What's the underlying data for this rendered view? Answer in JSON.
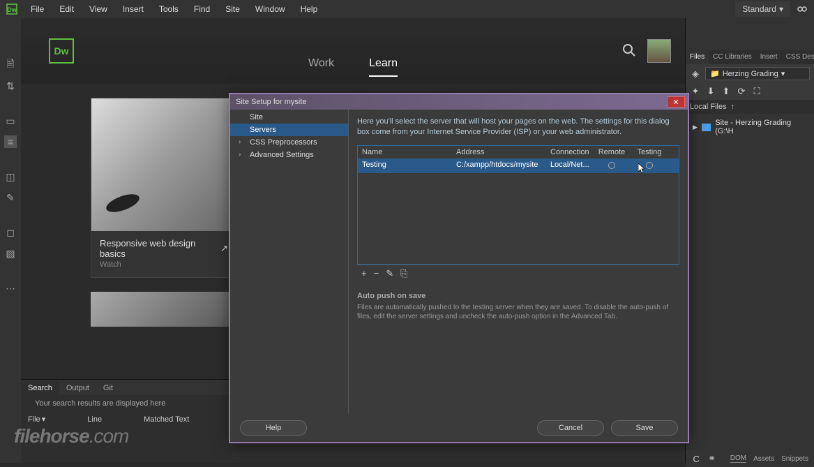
{
  "menubar": {
    "items": [
      "File",
      "Edit",
      "View",
      "Insert",
      "Tools",
      "Find",
      "Site",
      "Window",
      "Help"
    ],
    "workspace": "Standard"
  },
  "app_logo": "Dw",
  "center_tabs": {
    "work": "Work",
    "learn": "Learn"
  },
  "card": {
    "title": "Responsive web design basics",
    "sub": "Watch"
  },
  "bottom_panel": {
    "tabs": [
      "Search",
      "Output",
      "Git"
    ],
    "msg": "Your search results are displayed here",
    "cols": [
      "File",
      "Line",
      "Matched Text"
    ]
  },
  "watermark": {
    "a": "filehorse",
    "b": ".com"
  },
  "right_panel": {
    "tabs": [
      "Files",
      "CC Libraries",
      "Insert",
      "CSS Des"
    ],
    "site_selector": "Herzing Grading",
    "local_files": "Local Files",
    "file_item": "Site - Herzing Grading (G:\\H",
    "bottom_tabs": [
      "DOM",
      "Assets",
      "Snippets"
    ]
  },
  "dialog": {
    "title": "Site Setup for mysite",
    "sidebar": [
      "Site",
      "Servers",
      "CSS Preprocessors",
      "Advanced Settings"
    ],
    "description": "Here you'll select the server that will host your pages on the web. The settings for this dialog box come from your Internet Service Provider (ISP) or your web administrator.",
    "table": {
      "headers": {
        "name": "Name",
        "address": "Address",
        "connection": "Connection",
        "remote": "Remote",
        "testing": "Testing"
      },
      "row": {
        "name": "Testing",
        "address": "C:/xampp/htdocs/mysite",
        "connection": "Local/Net..."
      }
    },
    "autopush": {
      "title": "Auto push on save",
      "text": "Files are automatically pushed to the testing server when they are saved. To disable the auto-push of files, edit the server settings and uncheck the auto-push option in the Advanced Tab."
    },
    "buttons": {
      "help": "Help",
      "cancel": "Cancel",
      "save": "Save"
    }
  }
}
